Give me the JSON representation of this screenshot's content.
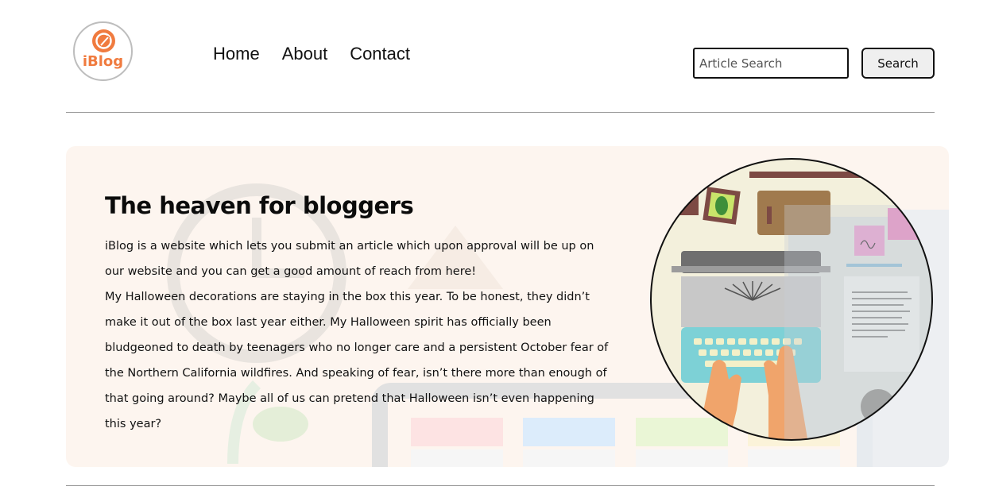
{
  "brand": {
    "logo_text": "iBlog"
  },
  "nav": {
    "items": [
      "Home",
      "About",
      "Contact"
    ]
  },
  "search": {
    "placeholder": "Article Search",
    "button_label": "Search"
  },
  "hero": {
    "title": "The heaven for bloggers",
    "paragraph_1": "iBlog is a website which lets you submit an article which upon approval will be up on our website and you can get a good amount of reach from here!",
    "paragraph_2": "My Halloween decorations are staying in the box this year. To be honest, they didn’t make it out of the box last year either. My Halloween spirit has officially been bludgeoned to death by teenagers who no longer care and a persistent October fear of the Northern California wildfires. And speaking of fear, isn’t there more than enough of that going around? Maybe all of us can pretend that Halloween isn’t even happening this year?"
  },
  "colors": {
    "brand_orange": "#f07b3f",
    "hero_background": "#fdf5ef"
  }
}
